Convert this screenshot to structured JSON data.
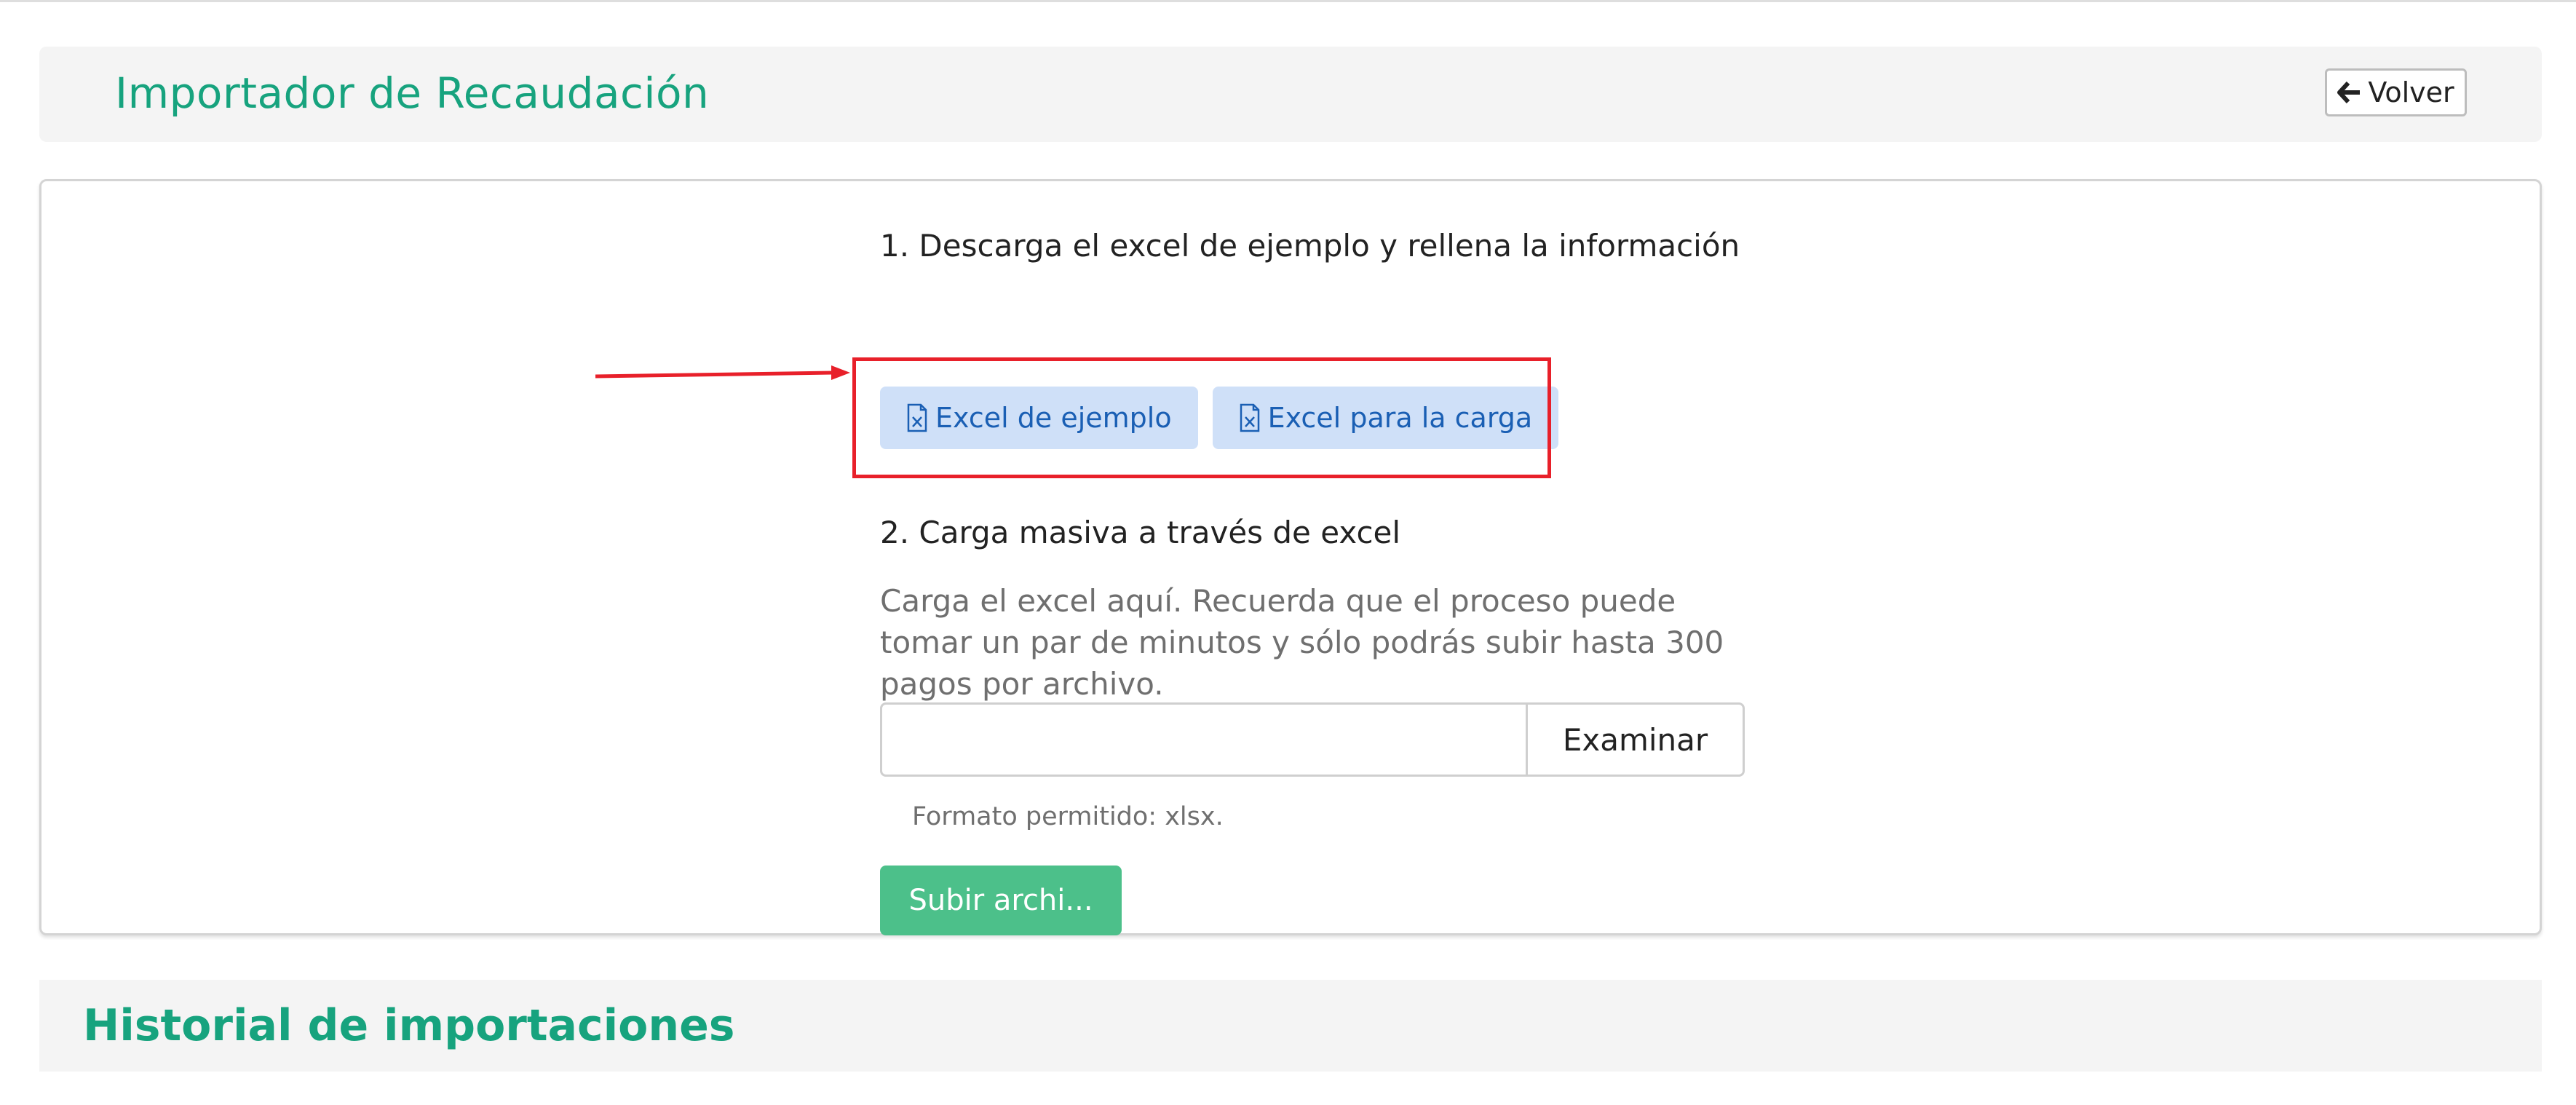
{
  "header": {
    "title": "Importador de Recaudación",
    "back_label": "Volver"
  },
  "importer": {
    "step1_text": "1. Descarga el excel de ejemplo y rellena la información",
    "buttons": [
      {
        "label": "Excel de ejemplo",
        "icon": "excel-file-icon"
      },
      {
        "label": "Excel para la carga",
        "icon": "excel-file-icon"
      }
    ],
    "step2_text": "2. Carga masiva a través de excel",
    "help_text": "Carga el excel aquí. Recuerda que el proceso puede tomar un par de minutos y sólo podrás subir hasta 300 pagos por archivo.",
    "file_value": "",
    "browse_label": "Examinar",
    "format_text": "Formato permitido: xlsx.",
    "upload_label": "Subir archi..."
  },
  "history": {
    "title": "Historial de importaciones"
  },
  "colors": {
    "accent_green": "#17a37e",
    "upload_button": "#4cc08a",
    "excel_button_bg": "#cfe0f8",
    "excel_button_text": "#1a5fb4",
    "annotation_red": "#e8202a"
  }
}
